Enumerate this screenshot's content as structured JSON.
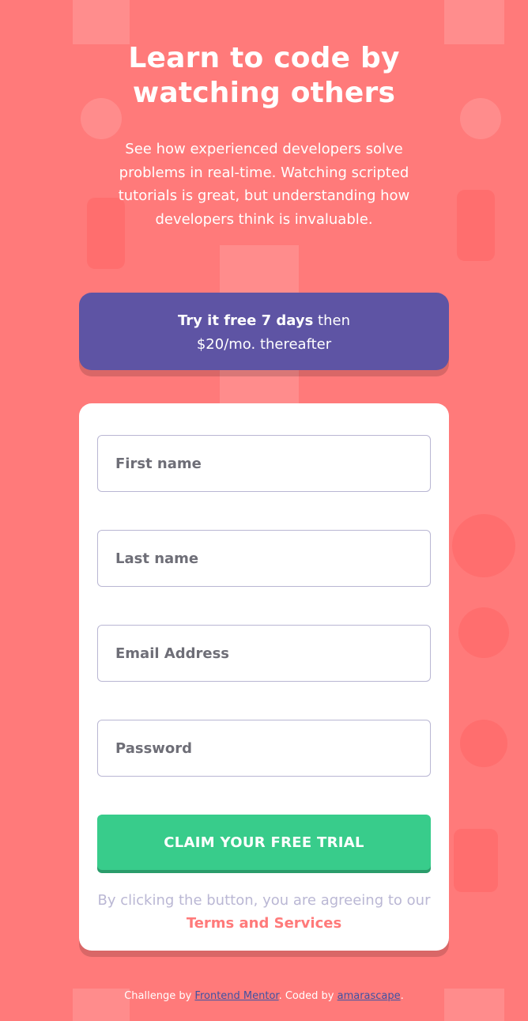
{
  "hero": {
    "title": "Learn to code by watching others",
    "description": "See how experienced developers solve problems in real-time. Watching scripted tutorials is great, but understanding how developers think is invaluable."
  },
  "promo": {
    "bold": "Try it free 7 days",
    "rest_line1": " then",
    "line2": "$20/mo. thereafter"
  },
  "form": {
    "first_name": {
      "placeholder": "First name",
      "value": ""
    },
    "last_name": {
      "placeholder": "Last name",
      "value": ""
    },
    "email": {
      "placeholder": "Email Address",
      "value": ""
    },
    "password": {
      "placeholder": "Password",
      "value": ""
    },
    "submit_label": "CLAIM YOUR FREE TRIAL",
    "terms_prefix": "By clicking the button, you are agreeing to our ",
    "terms_link": "Terms and Services"
  },
  "attribution": {
    "prefix": "Challenge by ",
    "link1": "Frontend Mentor",
    "middle": ". Coded by ",
    "link2": "amarascape",
    "suffix": "."
  },
  "colors": {
    "background": "#ff7a7a",
    "promo": "#5e54a4",
    "button": "#38cc8b",
    "accent": "#ff7a7a"
  }
}
